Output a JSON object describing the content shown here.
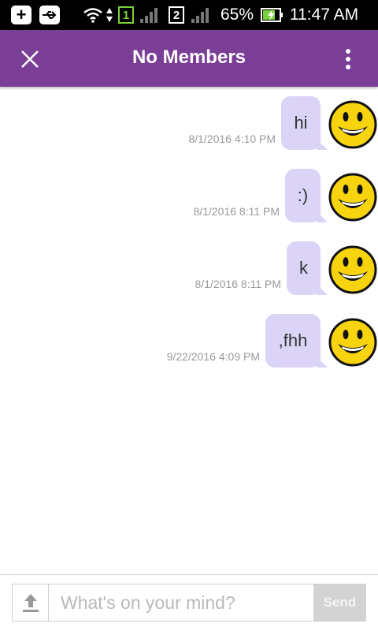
{
  "status_bar": {
    "sim1_label": "1",
    "sim2_label": "2",
    "battery_percent": "65%",
    "time": "11:47 AM"
  },
  "app_bar": {
    "title": "No Members"
  },
  "messages": [
    {
      "text": "hi",
      "timestamp": "8/1/2016 4:10 PM"
    },
    {
      "text": ":)",
      "timestamp": "8/1/2016 8:11 PM"
    },
    {
      "text": "k",
      "timestamp": "8/1/2016 8:11 PM"
    },
    {
      "text": ",fhh",
      "timestamp": "9/22/2016 4:09 PM"
    }
  ],
  "composer": {
    "placeholder": "What's on your mind?",
    "send_label": "Send"
  },
  "colors": {
    "app_bar": "#7b3e97",
    "bubble": "#dcd4f7",
    "send_disabled": "#d3d3d3"
  }
}
